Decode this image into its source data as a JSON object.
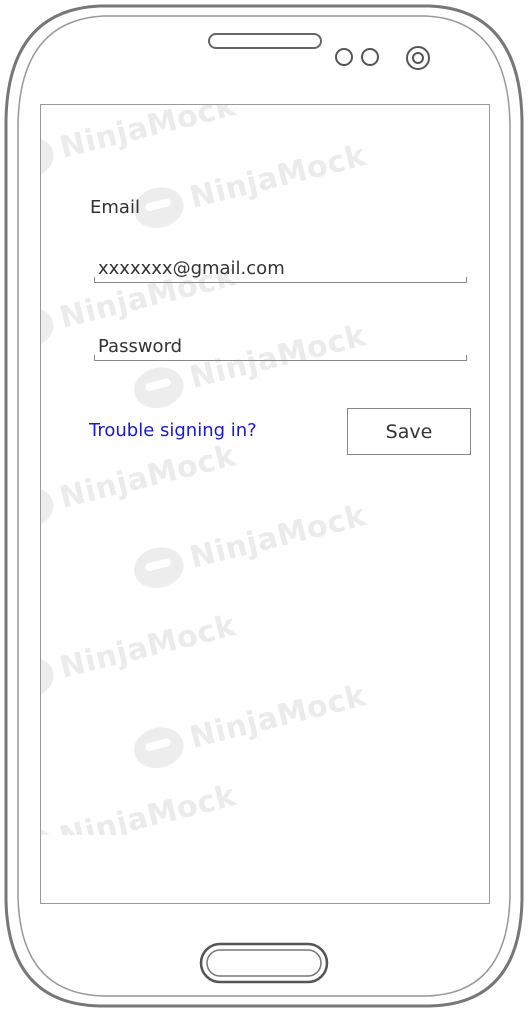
{
  "watermark": "NinjaMock",
  "form": {
    "email_label": "Email",
    "email_value": "xxxxxxx@gmail.com",
    "password_placeholder": "Password",
    "trouble_link": "Trouble signing in?",
    "save_label": "Save"
  },
  "colors": {
    "link": "#1a1acc",
    "frame": "#8a8a8a",
    "watermark": "#ebebeb"
  }
}
